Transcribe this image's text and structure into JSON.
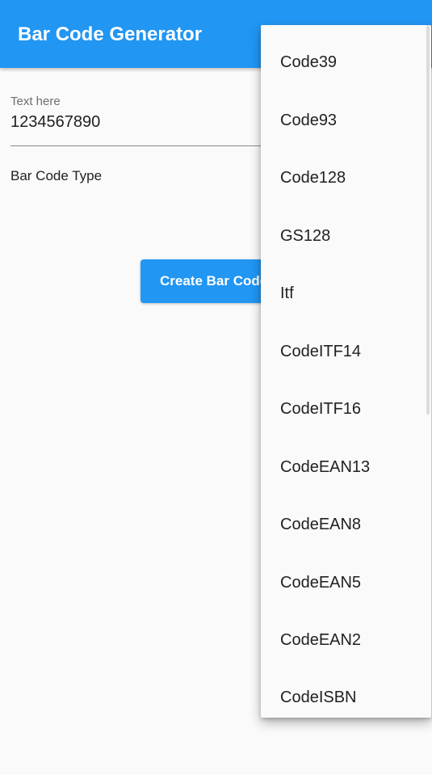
{
  "app_bar": {
    "title": "Bar Code Generator"
  },
  "text_field": {
    "label": "Text here",
    "value": "1234567890"
  },
  "barcode_type": {
    "label": "Bar Code Type"
  },
  "create_button": {
    "label": "Create Bar Code"
  },
  "dropdown": {
    "options": [
      "Code39",
      "Code93",
      "Code128",
      "GS128",
      "Itf",
      "CodeITF14",
      "CodeITF16",
      "CodeEAN13",
      "CodeEAN8",
      "CodeEAN5",
      "CodeEAN2",
      "CodeISBN"
    ]
  },
  "colors": {
    "primary": "#2196f3",
    "background": "#fafafa",
    "text": "#212121",
    "label": "#6e6e6e"
  }
}
